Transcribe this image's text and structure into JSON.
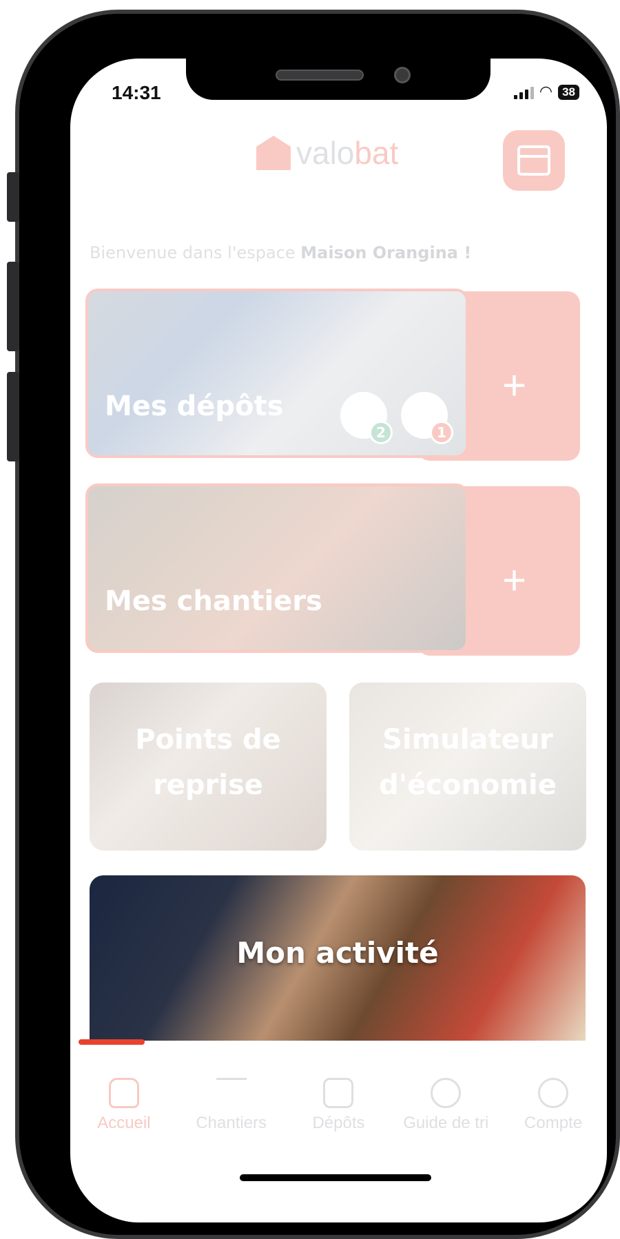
{
  "status": {
    "time": "14:31",
    "battery": "38"
  },
  "header": {
    "logo_part1": "valo",
    "logo_part2": "bat"
  },
  "welcome": {
    "prefix": "Bienvenue dans l'espace ",
    "name": "Maison Orangina !"
  },
  "tiles": {
    "depots": {
      "title": "Mes dépôts",
      "qr_count": "2",
      "alert_count": "1"
    },
    "chantiers": {
      "title": "Mes chantiers"
    },
    "points": {
      "title_line1": "Points de",
      "title_line2": "reprise"
    },
    "simulateur": {
      "title_line1": "Simulateur",
      "title_line2": "d'économie"
    },
    "activite": {
      "title": "Mon activité"
    },
    "plus": "+"
  },
  "tabs": [
    {
      "label": "Accueil",
      "icon": "home-icon"
    },
    {
      "label": "Chantiers",
      "icon": "crane-icon"
    },
    {
      "label": "Dépôts",
      "icon": "truck-icon"
    },
    {
      "label": "Guide de tri",
      "icon": "question-icon"
    },
    {
      "label": "Compte",
      "icon": "user-icon"
    }
  ],
  "colors": {
    "accent": "#e9422c",
    "muted": "#8a8f99",
    "qr_badge": "#2e9e6e",
    "alert_badge": "#e9422c"
  }
}
